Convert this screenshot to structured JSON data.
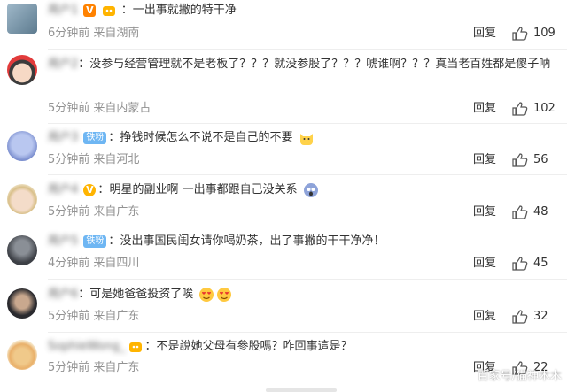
{
  "comments": [
    {
      "username": "用户1",
      "text": "一出事就撇的特干净",
      "meta": "6分钟前 来自湖南",
      "reply": "回复",
      "likes": "109"
    },
    {
      "username": "用户2",
      "text": "没参与经营管理就不是老板了？？？就没参股了？？？唬谁啊？？？真当老百姓都是傻子呐",
      "meta": "5分钟前 来自内蒙古",
      "reply": "回复",
      "likes": "102"
    },
    {
      "username": "用户3",
      "badge": "铁粉",
      "text": "挣钱时候怎么不说不是自己的不要",
      "meta": "5分钟前 来自河北",
      "reply": "回复",
      "likes": "56"
    },
    {
      "username": "用户4",
      "text": "明星的副业啊 一出事都跟自己没关系",
      "meta": "5分钟前 来自广东",
      "reply": "回复",
      "likes": "48"
    },
    {
      "username": "用户5",
      "badge": "铁粉",
      "text": "没出事国民闺女请你喝奶茶，出了事撇的干干净净！",
      "meta": "4分钟前 来自四川",
      "reply": "回复",
      "likes": "45"
    },
    {
      "username": "用户6",
      "text": "可是她爸爸投资了唉",
      "meta": "5分钟前 来自广东",
      "reply": "回复",
      "likes": "32"
    },
    {
      "username": "SophieWong_",
      "text": "不是說她父母有參股嗎？咋回事這是？",
      "meta": "5分钟前 来自广东",
      "reply": "回复",
      "likes": "22"
    }
  ],
  "watermark": "百家号/猫神木木",
  "colors": {
    "accent": "#ff8200",
    "meta": "#939393",
    "fan_badge": "#6eb6f3"
  }
}
